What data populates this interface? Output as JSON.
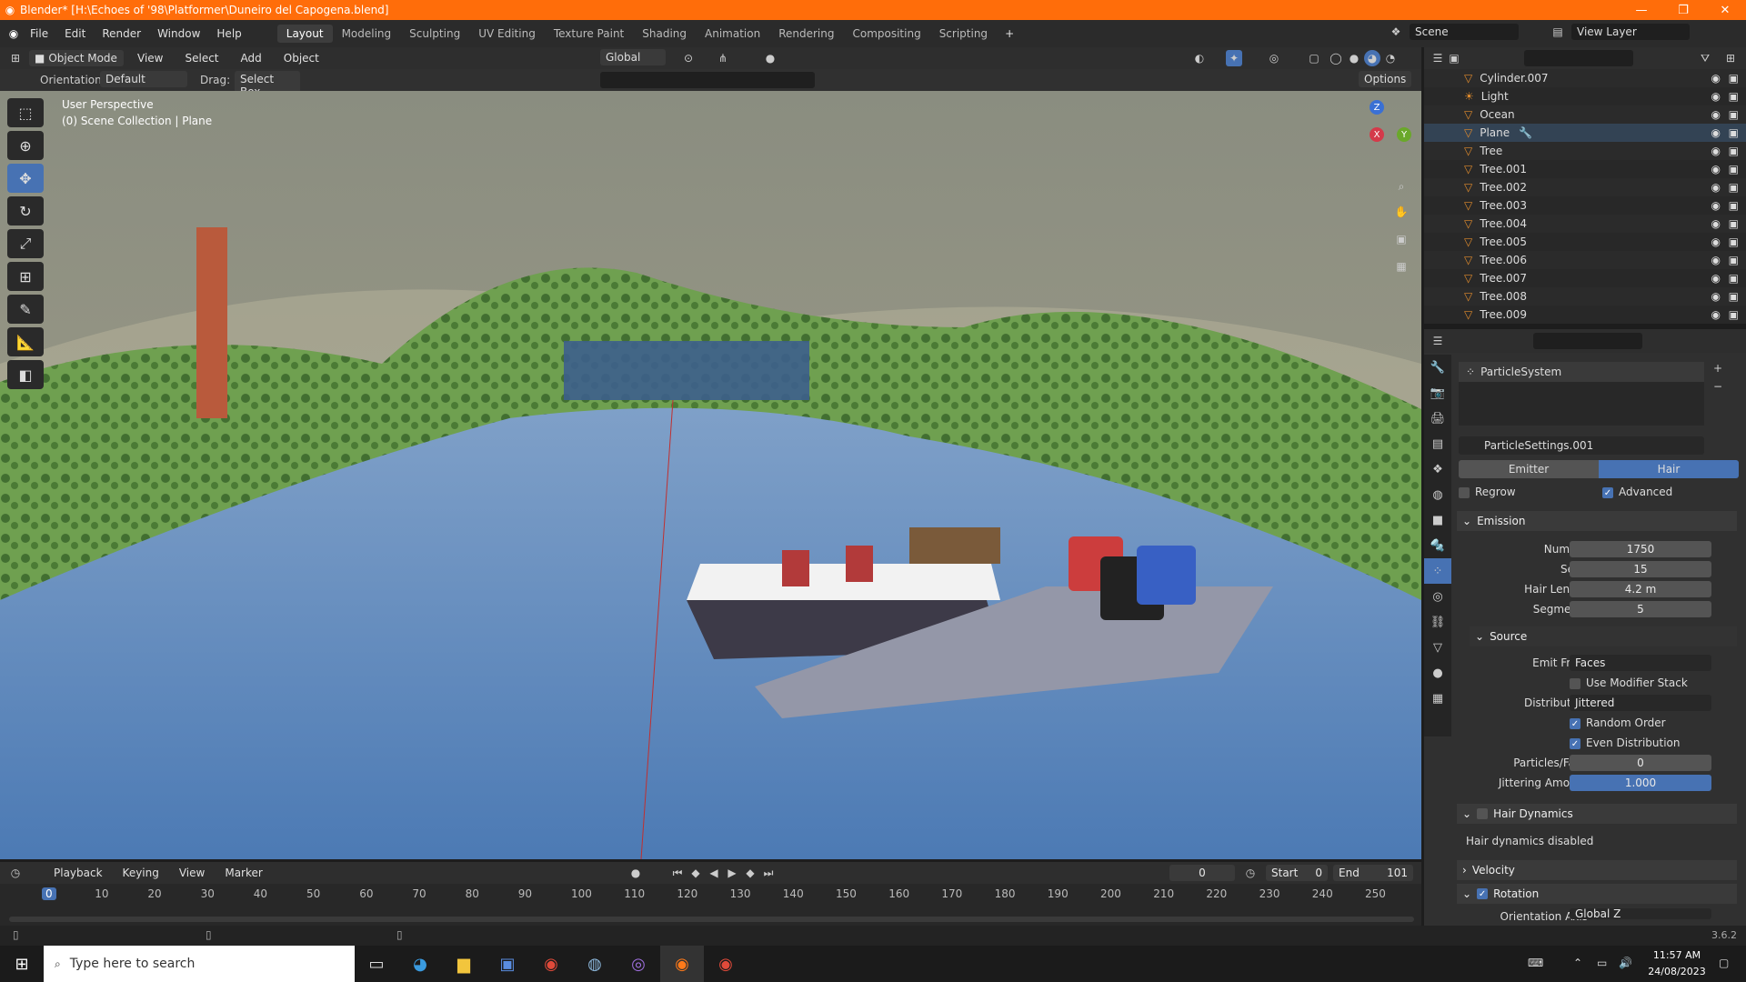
{
  "window": {
    "title": "Blender* [H:\\Echoes of '98\\Platformer\\Duneiro del Capogena.blend]"
  },
  "menu": [
    "File",
    "Edit",
    "Render",
    "Window",
    "Help"
  ],
  "workspaces": [
    "Layout",
    "Modeling",
    "Sculpting",
    "UV Editing",
    "Texture Paint",
    "Shading",
    "Animation",
    "Rendering",
    "Compositing",
    "Scripting"
  ],
  "scene": {
    "name": "Scene",
    "view_layer": "View Layer"
  },
  "view_header": {
    "mode": "Object Mode",
    "menus": [
      "View",
      "Select",
      "Add",
      "Object"
    ],
    "transform": "Global"
  },
  "tool_settings": {
    "orientation_label": "Orientation:",
    "orientation": "Default",
    "drag_label": "Drag:",
    "drag": "Select Box",
    "options": "Options"
  },
  "viewport": {
    "perspective": "User Perspective",
    "collection": "(0) Scene Collection | Plane"
  },
  "gizmo": {
    "z": "Z",
    "y": "Y",
    "x": "X"
  },
  "outliner": [
    "Cylinder.007",
    "Light",
    "Ocean",
    "Plane",
    "Tree",
    "Tree.001",
    "Tree.002",
    "Tree.003",
    "Tree.004",
    "Tree.005",
    "Tree.006",
    "Tree.007",
    "Tree.008",
    "Tree.009"
  ],
  "properties": {
    "particle_system": "ParticleSystem",
    "settings": "ParticleSettings.001",
    "type_tabs": [
      "Emitter",
      "Hair"
    ],
    "regrow": "Regrow",
    "advanced": "Advanced",
    "emission": {
      "header": "Emission",
      "number_label": "Number",
      "number": "1750",
      "seed_label": "Seed",
      "seed": "15",
      "hair_length_label": "Hair Length",
      "hair_length": "4.2 m",
      "segments_label": "Segments",
      "segments": "5"
    },
    "source": {
      "header": "Source",
      "emit_from_label": "Emit From",
      "emit_from": "Faces",
      "use_modifier_stack": "Use Modifier Stack",
      "distribution_label": "Distribution",
      "distribution": "Jittered",
      "random_order": "Random Order",
      "even_distribution": "Even Distribution",
      "particles_face_label": "Particles/Face",
      "particles_face": "0",
      "jittering_label": "Jittering Amount",
      "jittering": "1.000"
    },
    "hair_dynamics": {
      "header": "Hair Dynamics",
      "status": "Hair dynamics disabled"
    },
    "velocity": "Velocity",
    "rotation": {
      "header": "Rotation",
      "orientation_axis_label": "Orientation Axis",
      "orientation_axis": "Global Z"
    }
  },
  "timeline": {
    "menus": [
      "Playback",
      "Keying",
      "View",
      "Marker"
    ],
    "current_frame": "0",
    "start_label": "Start",
    "start": "0",
    "end_label": "End",
    "end": "101",
    "ticks": [
      "0",
      "10",
      "20",
      "30",
      "40",
      "50",
      "60",
      "70",
      "80",
      "90",
      "100",
      "110",
      "120",
      "130",
      "140",
      "150",
      "160",
      "170",
      "180",
      "190",
      "200",
      "210",
      "220",
      "230",
      "240",
      "250"
    ]
  },
  "status": {
    "version": "3.6.2"
  },
  "taskbar": {
    "search_placeholder": "Type here to search",
    "time": "11:57 AM",
    "date": "24/08/2023"
  }
}
